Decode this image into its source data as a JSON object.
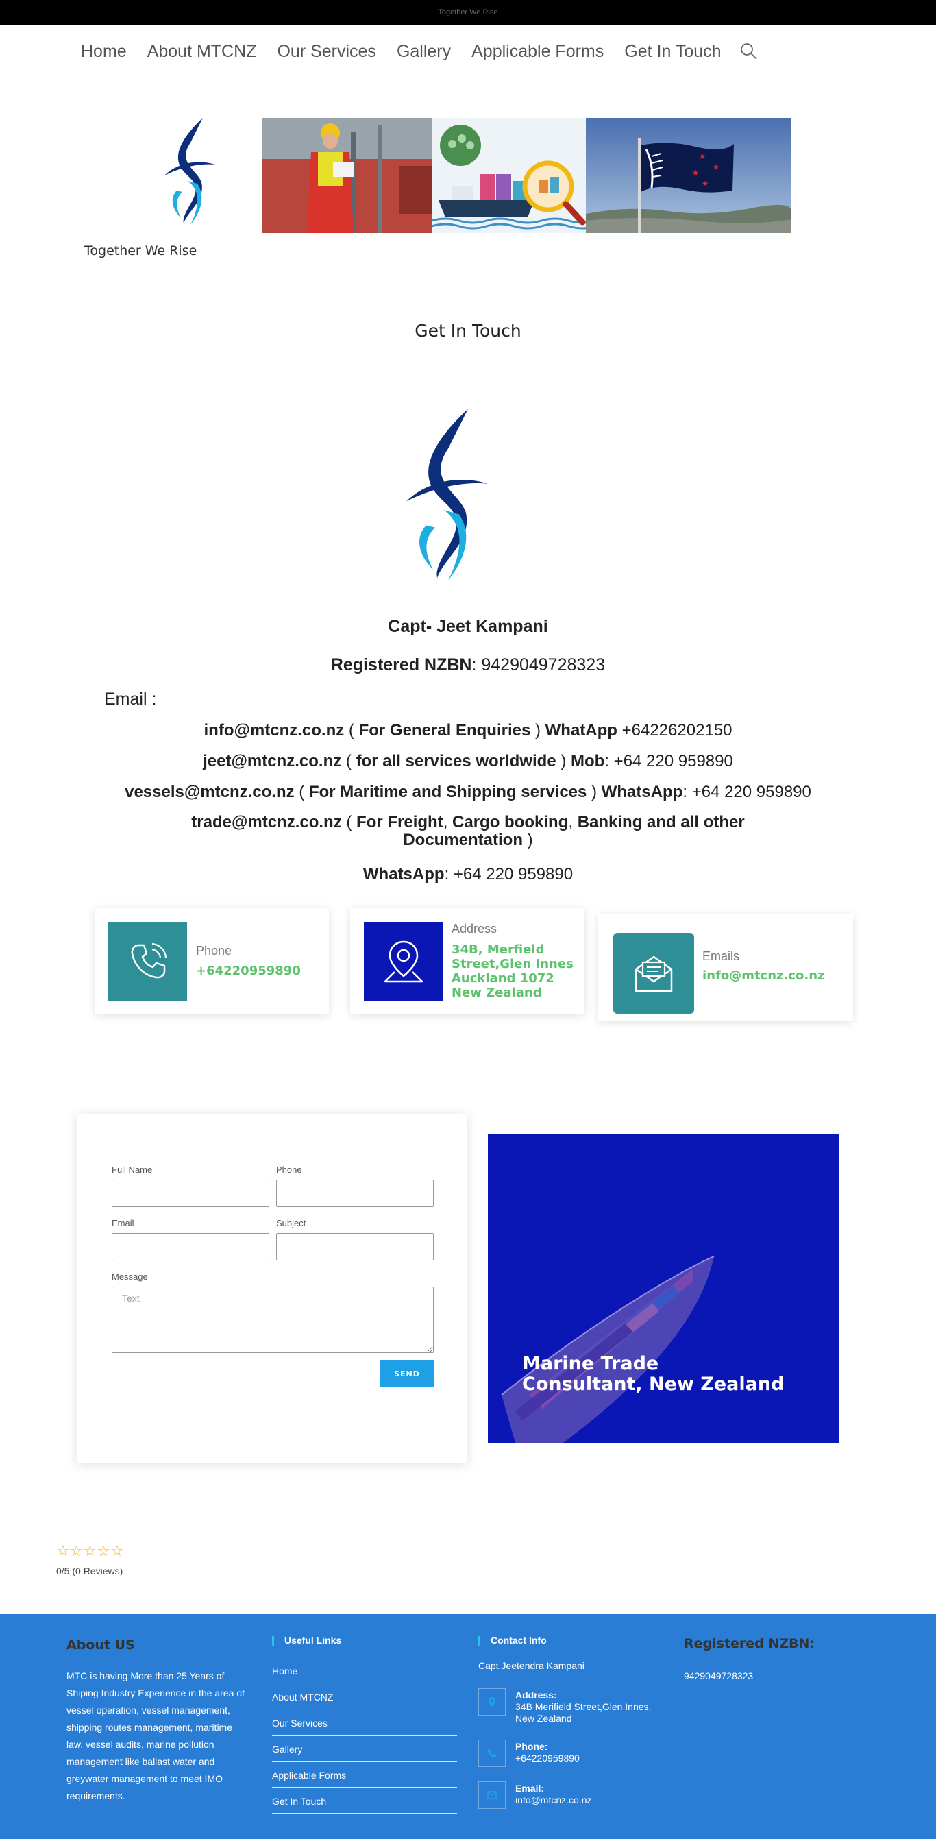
{
  "topbar": {
    "text": "Together We Rise"
  },
  "nav": {
    "items": [
      "Home",
      "About MTCNZ",
      "Our Services",
      "Gallery",
      "Applicable Forms",
      "Get In Touch"
    ]
  },
  "header": {
    "tagline": "Together We Rise"
  },
  "page": {
    "title": "Get In Touch"
  },
  "contact": {
    "name_prefix": "Capt",
    "name": "- Jeet Kampani",
    "nzbn_label": "Registered NZBN",
    "nzbn_value": ": 9429049728323",
    "email_label": "Email :",
    "lines": [
      {
        "email": "info@mtcnz.co.nz",
        "open": " ( ",
        "desc": "For General Enquiries",
        "close": " ) ",
        "label": "WhatApp",
        "sep": " ",
        "value": "+64226202150"
      },
      {
        "email": "jeet@mtcnz.co.nz",
        "open": " ( ",
        "desc": "for all services worldwide",
        "close": " ) ",
        "label": "Mob",
        "sep": ": ",
        "value": "+64 220 959890"
      },
      {
        "email": "vessels@mtcnz.co.nz",
        "open": " ( ",
        "desc": "For Maritime and Shipping services",
        "close": " ) ",
        "label": "WhatsApp",
        "sep": ": ",
        "value": "+64 220 959890"
      }
    ],
    "trade": {
      "email": "trade@mtcnz.co.nz",
      "open": " ( ",
      "desc1": "For Freight",
      "c1": ", ",
      "desc2": "Cargo booking",
      "c2": ", ",
      "desc3": "Banking and all other",
      "desc4": "Documentation",
      "close": " )"
    },
    "whatsapp_label": "WhatsApp",
    "whatsapp_value": ": +64 220 959890"
  },
  "cards": {
    "phone": {
      "label": "Phone",
      "value": "+64220959890"
    },
    "address": {
      "label": "Address",
      "line1": "34B, Merfield",
      "line2": "Street,Glen Innes",
      "line3": "Auckland 1072",
      "line4": "New Zealand"
    },
    "emails": {
      "label": "Emails",
      "value": "info@mtcnz.co.nz"
    }
  },
  "form": {
    "full_name_label": "Full Name",
    "phone_label": "Phone",
    "email_label": "Email",
    "subject_label": "Subject",
    "message_label": "Message",
    "message_placeholder": "Text",
    "send_label": "SEND"
  },
  "promo": {
    "line1": "Marine Trade",
    "line2": "Consultant, New Zealand"
  },
  "rating": {
    "stars": "☆☆☆☆☆",
    "text": "0/5 (0 Reviews)",
    "value": 0,
    "max": 5
  },
  "footer": {
    "about_title": "About US",
    "about_text": "MTC is having More than 25 Years of Shiping Industry Experience in the area of vessel operation, vessel management, shipping routes management, maritime law, vessel audits, marine pollution management like ballast water and greywater management to meet IMO requirements.",
    "links_title": "Useful Links",
    "links": [
      "Home",
      "About MTCNZ",
      "Our Services",
      "Gallery",
      "Applicable Forms",
      "Get In Touch"
    ],
    "contact_title": "Contact Info",
    "contact_person": "Capt.Jeetendra Kampani",
    "address_label": "Address:",
    "address_value": "34B Merifield Street,Glen Innes, New Zealand",
    "phone_label": "Phone:",
    "phone_value": "+64220959890",
    "email_label": "Email:",
    "email_value": "info@mtcnz.co.nz",
    "nzbn_title": "Registered NZBN:",
    "nzbn_value": "9429049728323"
  },
  "colors": {
    "footer_bg": "#2a7dd4",
    "accent_green": "#5cc26b",
    "promo_blue": "#0a17b5",
    "teal": "#2e8f97",
    "send_blue": "#1ea0e6"
  }
}
